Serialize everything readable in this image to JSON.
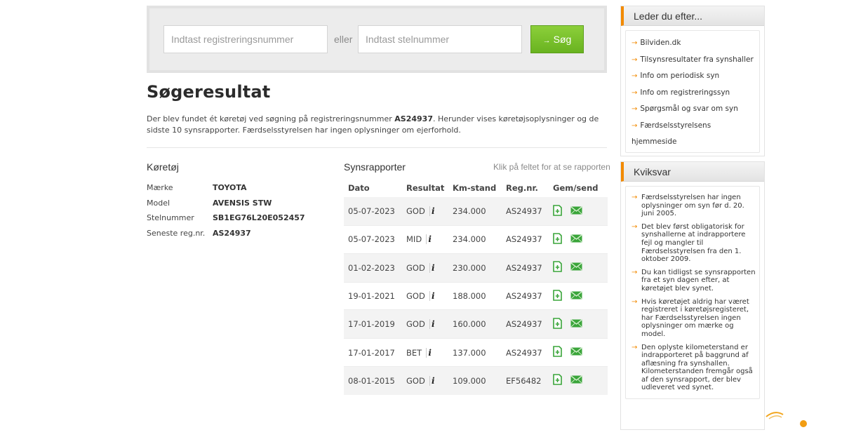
{
  "search": {
    "reg_placeholder": "Indtast registreringsnummer",
    "or_label": "eller",
    "stel_placeholder": "Indtast stelnummer",
    "button_label": "Søg",
    "button_arrow": "→"
  },
  "result": {
    "title": "Søgeresultat",
    "text_before": "Der blev fundet ét køretøj ved søgning på registreringsnummer ",
    "reg_number": "AS24937",
    "text_after": ". Herunder vises køretøjsoplysninger og de sidste 10 synsrapporter. Færdselsstyrelsen har ingen oplysninger om ejerforhold."
  },
  "vehicle": {
    "heading": "Køretøj",
    "rows": [
      {
        "label": "Mærke",
        "value": "TOYOTA"
      },
      {
        "label": "Model",
        "value": "AVENSIS STW"
      },
      {
        "label": "Stelnummer",
        "value": "SB1EG76L20E052457"
      },
      {
        "label": "Seneste reg.nr.",
        "value": "AS24937"
      }
    ]
  },
  "reports": {
    "heading": "Synsrapporter",
    "hint": "Klik på feltet for at se rapporten",
    "columns": [
      "Dato",
      "Resultat",
      "Km-stand",
      "Reg.nr.",
      "Gem/send"
    ],
    "info_glyph": "i",
    "rows": [
      {
        "date": "05-07-2023",
        "result": "GOD",
        "km": "234.000",
        "reg": "AS24937"
      },
      {
        "date": "05-07-2023",
        "result": "MID",
        "km": "234.000",
        "reg": "AS24937"
      },
      {
        "date": "01-02-2023",
        "result": "GOD",
        "km": "230.000",
        "reg": "AS24937"
      },
      {
        "date": "19-01-2021",
        "result": "GOD",
        "km": "188.000",
        "reg": "AS24937"
      },
      {
        "date": "17-01-2019",
        "result": "GOD",
        "km": "160.000",
        "reg": "AS24937"
      },
      {
        "date": "17-01-2017",
        "result": "BET",
        "km": "137.000",
        "reg": "AS24937"
      },
      {
        "date": "08-01-2015",
        "result": "GOD",
        "km": "109.000",
        "reg": "EF56482"
      }
    ]
  },
  "sidebar": {
    "links_title": "Leder du efter...",
    "links": [
      "Bilviden.dk",
      "Tilsynsresultater fra synshaller",
      "Info om periodisk syn",
      "Info om registreringssyn",
      "Spørgsmål og svar om syn",
      "Færdselsstyrelsens hjemmeside"
    ],
    "faq_title": "Kviksvar",
    "faq": [
      "Færdselsstyrelsen har ingen oplysninger om syn før d. 20. juni 2005.",
      "Det blev først obligatorisk for synshallerne at indrapportere fejl og mangler til Færdselsstyrelsen fra den 1. oktober 2009.",
      "Du kan tidligst se synsrapporten fra et syn dagen efter, at køretøjet blev synet.",
      "Hvis køretøjet aldrig har været registreret i køretøjsregisteret, har Færdselsstyrelsen ingen oplysninger om mærke og model.",
      "Den oplyste kilometerstand er indrapporteret på baggrund af aflæsning fra synshallen. Kilometerstanden fremgår også af den synsrapport, der blev udleveret ved synet."
    ],
    "arrow": "→"
  },
  "colors": {
    "accent": "#f28a00",
    "button_green": "#69b320",
    "icon_green": "#3aa53a"
  },
  "icons": {
    "doc": "save-document-icon",
    "mail": "email-envelope-icon",
    "info": "info-icon"
  }
}
